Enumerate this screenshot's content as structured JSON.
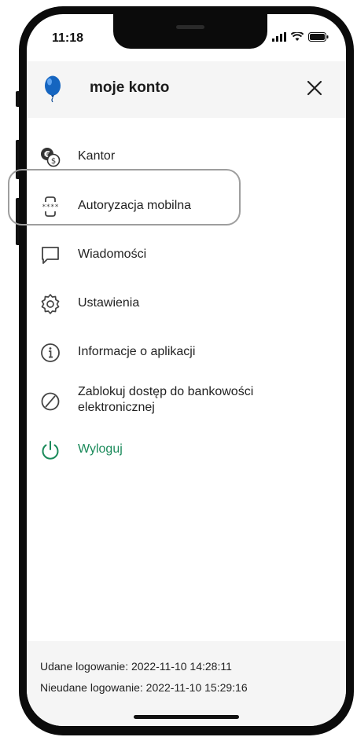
{
  "status_bar": {
    "time": "11:18"
  },
  "header": {
    "title": "moje konto",
    "close_icon": "close-icon"
  },
  "menu": {
    "items": [
      {
        "label": "Kantor",
        "icon": "currency-exchange-icon"
      },
      {
        "label": "Autoryzacja mobilna",
        "icon": "mobile-authorization-icon",
        "highlighted": true
      },
      {
        "label": "Wiadomości",
        "icon": "message-icon"
      },
      {
        "label": "Ustawienia",
        "icon": "gear-icon"
      },
      {
        "label": "Informacje o aplikacji",
        "icon": "info-icon"
      },
      {
        "label": "Zablokuj dostęp do bankowości elektronicznej",
        "icon": "block-icon"
      },
      {
        "label": "Wyloguj",
        "icon": "power-icon"
      }
    ]
  },
  "footer": {
    "successful_login": "Udane logowanie: 2022-11-10 14:28:11",
    "failed_login": "Nieudane logowanie: 2022-11-10 15:29:16"
  },
  "colors": {
    "accent_green": "#1a8a5a",
    "logo_blue": "#1565c0",
    "header_bg": "#f5f5f5"
  }
}
